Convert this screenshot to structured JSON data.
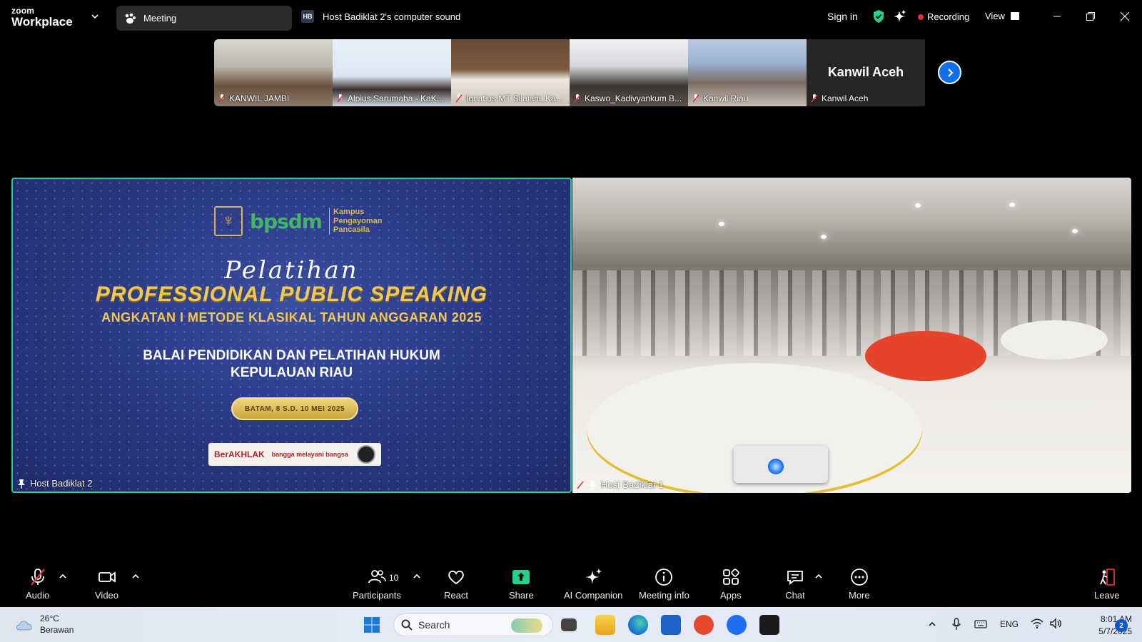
{
  "titlebar": {
    "brand_top": "zoom",
    "brand_bottom": "Workplace",
    "meeting_tab": "Meeting",
    "sound_badge": "HB",
    "sound_tab": "Host Badiklat 2's computer sound",
    "signin": "Sign in",
    "recording": "Recording",
    "view": "View"
  },
  "thumbnails": [
    {
      "name": "KANWIL JAMBI",
      "muted": true
    },
    {
      "name": "Alpius Sarumaha - KaK...",
      "muted": true
    },
    {
      "name": "Ignatius MT Silalahi_Ka...",
      "muted": true
    },
    {
      "name": "Kaswo_Kadivyankum B...",
      "muted": true
    },
    {
      "name": "Kanwil Riau",
      "muted": true
    },
    {
      "name": "Kanwil Aceh",
      "muted": true,
      "video_off": true
    }
  ],
  "main_left": {
    "participant": "Host Badiklat 2",
    "slide": {
      "logo_text": "bpsdm",
      "kampus": [
        "Kampus",
        "Pengayoman",
        "Pancasila"
      ],
      "pelatihan": "Pelatihan",
      "title": "PROFESSIONAL PUBLIC SPEAKING",
      "subtitle": "ANGKATAN I METODE KLASIKAL TAHUN ANGGARAN 2025",
      "balai_line1": "BALAI PENDIDIKAN DAN PELATIHAN HUKUM",
      "balai_line2": "KEPULAUAN RIAU",
      "date": "BATAM, 8 S.D. 10 MEI 2025",
      "berakhlak": "BerAKHLAK",
      "bangga": "bangga melayani bangsa"
    }
  },
  "main_right": {
    "participant": "Host Badiklat 1"
  },
  "toolbar": {
    "audio": "Audio",
    "video": "Video",
    "participants": "Participants",
    "participants_count": "10",
    "react": "React",
    "share": "Share",
    "ai_companion": "AI Companion",
    "meeting_info": "Meeting info",
    "apps": "Apps",
    "chat": "Chat",
    "more": "More",
    "leave": "Leave"
  },
  "taskbar": {
    "temp": "26°C",
    "weather": "Berawan",
    "search": "Search",
    "lang": "ENG",
    "time": "8:01 AM",
    "date": "5/7/2025",
    "notifications": "2"
  },
  "colors": {
    "active_speaker": "#23d18b",
    "recording_dot": "#e8303c",
    "share_green": "#23d18b",
    "accent_blue": "#0e71eb",
    "muted_red": "#e8303c"
  }
}
